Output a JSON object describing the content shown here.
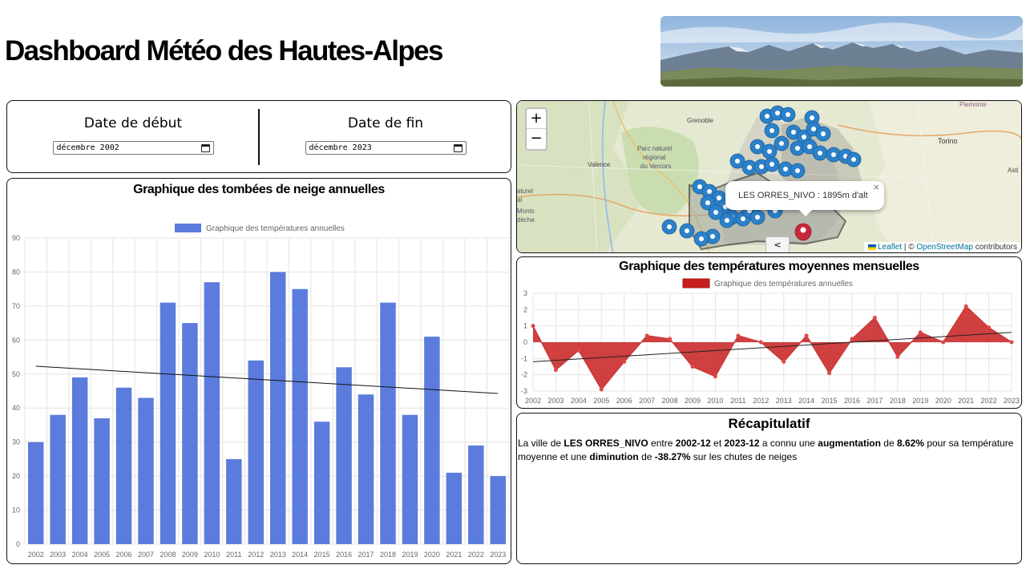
{
  "page": {
    "title": "Dashboard Météo des Hautes-Alpes"
  },
  "dates": {
    "start_label": "Date de début",
    "start_value": "décembre 2002",
    "end_label": "Date de fin",
    "end_value": "décembre 2023"
  },
  "map": {
    "zoom_in": "+",
    "zoom_out": "−",
    "popup_text": "LES ORRES_NIVO : 1895m d'alt",
    "popup_close": "×",
    "collapse_label": "<",
    "attribution_leaflet": "Leaflet",
    "attribution_sep": " | © ",
    "attribution_osm": "OpenStreetMap",
    "attribution_tail": " contributors",
    "place_labels": [
      "Grenoble",
      "Valence",
      "Parc naturel",
      "régional",
      "du Vercors",
      "Torino",
      "Asti",
      "Piemonte",
      "aturel",
      "al",
      "Monts",
      "dèche"
    ]
  },
  "snow_chart": {
    "title": "Graphique des tombées de neige annuelles",
    "chart_data": {
      "type": "bar",
      "categories": [
        "2002",
        "2003",
        "2004",
        "2005",
        "2006",
        "2007",
        "2008",
        "2009",
        "2010",
        "2011",
        "2012",
        "2013",
        "2014",
        "2015",
        "2016",
        "2017",
        "2018",
        "2019",
        "2020",
        "2021",
        "2022",
        "2023"
      ],
      "series": [
        {
          "name": "Graphique des températures annuelles",
          "values": [
            30,
            38,
            49,
            37,
            46,
            43,
            71,
            65,
            77,
            25,
            54,
            80,
            75,
            36,
            52,
            44,
            71,
            38,
            61,
            21,
            29,
            20
          ]
        }
      ],
      "trend": [
        52.3,
        44.3
      ],
      "ylim": [
        0,
        90
      ],
      "yticks": [
        0,
        10,
        20,
        30,
        40,
        50,
        60,
        70,
        80,
        90
      ],
      "grid": true,
      "legend": "top",
      "color": "#5b7bdd"
    }
  },
  "temp_chart": {
    "title": "Graphique des températures moyennes mensuelles",
    "chart_data": {
      "type": "area",
      "categories": [
        "2002",
        "2003",
        "2004",
        "2005",
        "2006",
        "2007",
        "2008",
        "2009",
        "2010",
        "2011",
        "2012",
        "2013",
        "2014",
        "2015",
        "2016",
        "2017",
        "2018",
        "2019",
        "2020",
        "2021",
        "2022",
        "2023"
      ],
      "series": [
        {
          "name": "Graphique des températures annuelles",
          "values": [
            1.0,
            -1.7,
            -0.5,
            -2.9,
            -1.2,
            0.4,
            0.2,
            -1.5,
            -2.1,
            0.4,
            0.0,
            -1.2,
            0.4,
            -1.9,
            0.2,
            1.5,
            -0.9,
            0.6,
            0.0,
            2.2,
            0.9,
            0.0
          ]
        }
      ],
      "trend": [
        -1.2,
        0.6
      ],
      "ylim": [
        -3,
        3
      ],
      "yticks": [
        -3,
        -2,
        -1,
        0,
        1,
        2,
        3
      ],
      "grid": true,
      "legend": "top",
      "color": "#c81e1e"
    }
  },
  "recap": {
    "title": "Récapitulatif",
    "t1": "La ville de ",
    "city": "LES ORRES_NIVO",
    "t2": " entre ",
    "date_start": "2002-12",
    "t3": " et ",
    "date_end": "2023-12",
    "t4": " a connu une ",
    "trend_temp": "augmentation",
    "t5": " de ",
    "pct_temp": "8.62%",
    "t6": " pour sa température moyenne et une ",
    "trend_snow": "diminution",
    "t7": " de ",
    "pct_snow": "-38.27%",
    "t8": " sur les chutes de neiges"
  }
}
